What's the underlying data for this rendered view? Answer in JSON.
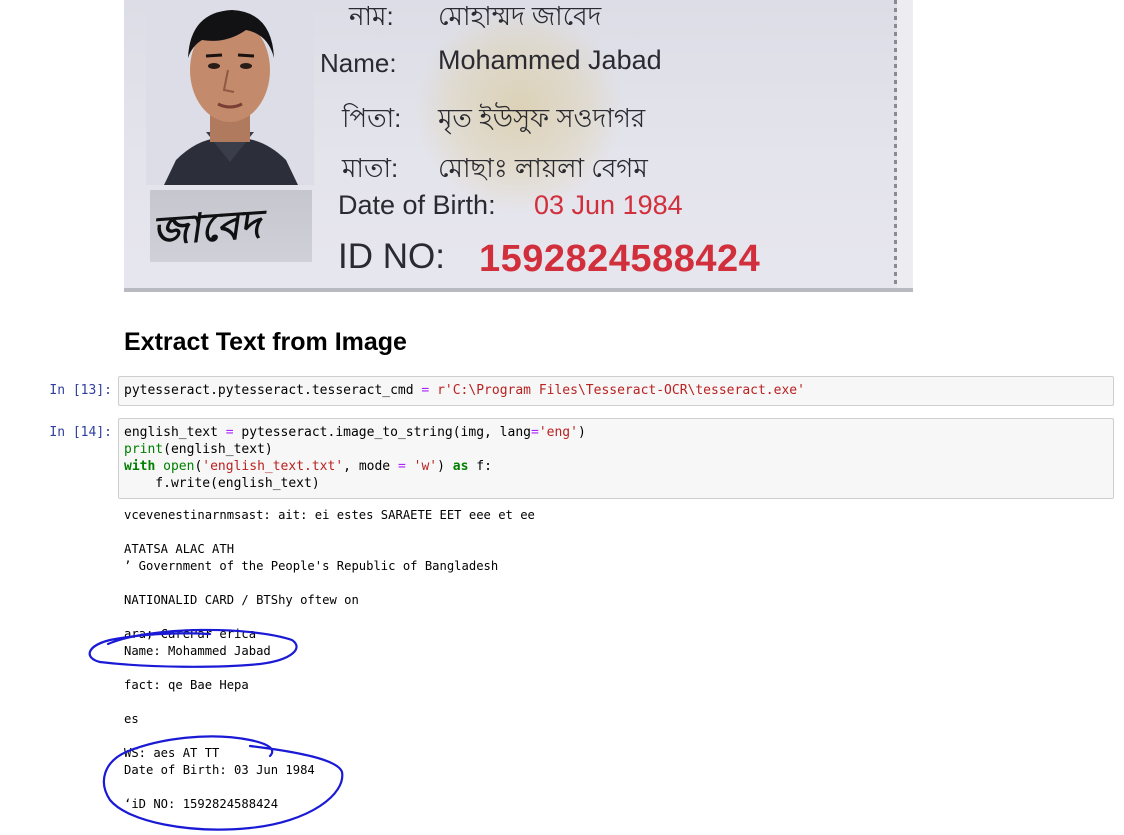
{
  "card": {
    "bn_name_label": "নাম:",
    "bn_name_value": "মোহাম্মদ জাবেদ",
    "name_label": "Name:",
    "name_value": "Mohammed Jabad",
    "bn_father_label": "পিতা:",
    "bn_father_value": "মৃত ইউসুফ সওদাগর",
    "bn_mother_label": "মাতা:",
    "bn_mother_value": "মোছাঃ লায়লা বেগম",
    "dob_label": "Date of Birth:",
    "dob_value": "03 Jun 1984",
    "id_label": "ID NO:",
    "id_value": "1592824588424",
    "signature": "জাবেদ",
    "colors": {
      "accent_red": "#d22f3c",
      "annotation_blue": "#1a1ad6"
    }
  },
  "section_title": "Extract Text from Image",
  "cells": [
    {
      "prompt": "In [13]:",
      "code": [
        [
          "pytesseract.pytesseract.tesseract_cmd ",
          "=",
          " ",
          "r'C:\\Program Files\\Tesseract-OCR\\tesseract.exe'"
        ]
      ]
    },
    {
      "prompt": "In [14]:",
      "code": [
        [
          "english_text ",
          "=",
          " pytesseract.image_to_string(img, lang",
          "=",
          "'eng'",
          ")"
        ],
        [
          "print",
          "(english_text)"
        ],
        [
          "with",
          " ",
          "open",
          "(",
          "'english_text.txt'",
          ", mode ",
          "=",
          " ",
          "'w'",
          ") ",
          "as",
          " f:"
        ],
        [
          "    f.write(english_text)"
        ]
      ],
      "output": [
        "vcevenestinarnmsast: ait: ei estes SARAETE EET eee et ee",
        "",
        "ATATSA ALAC ATH",
        "’ Government of the People's Republic of Bangladesh",
        "",
        "NATIONALID CARD / BTShy oftew on",
        "",
        "ara; CarePar erica",
        "Name: Mohammed Jabad",
        "",
        "fact: qe Bae Hepa",
        "",
        "es",
        "",
        "WS: aes AT TT",
        "Date of Birth: 03 Jun 1984",
        "",
        "‘iD NO: 1592824588424"
      ]
    }
  ]
}
